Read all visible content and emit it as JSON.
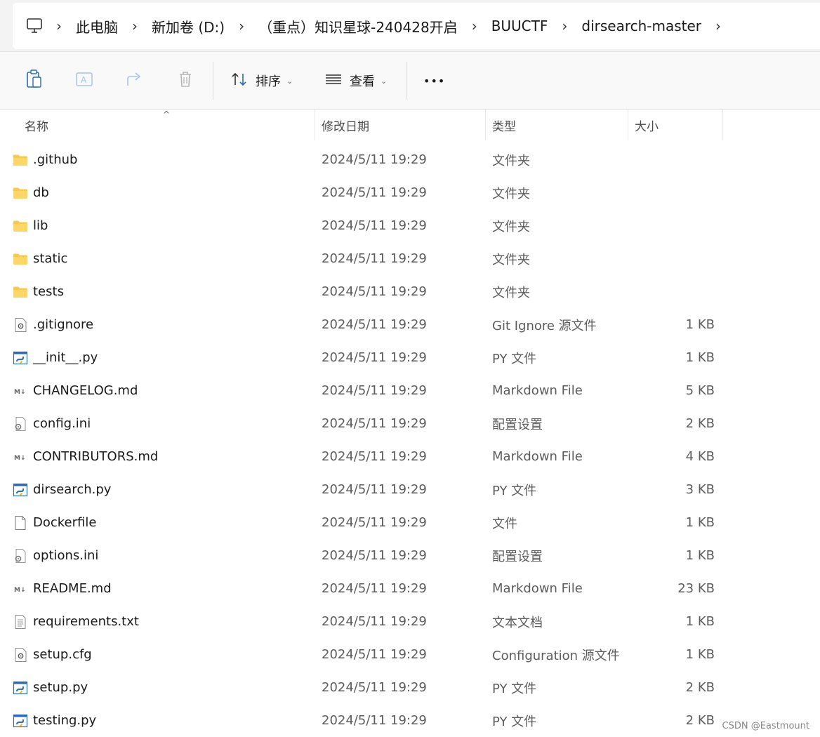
{
  "address": {
    "icon": "computer-icon",
    "crumbs": [
      "此电脑",
      "新加卷 (D:)",
      "（重点）知识星球-240428开启",
      "BUUCTF",
      "dirsearch-master"
    ],
    "separator": "›"
  },
  "toolbar": {
    "sort_label": "排序",
    "view_label": "查看",
    "more_label": "•••"
  },
  "columns": {
    "name": "名称",
    "date": "修改日期",
    "type": "类型",
    "size": "大小"
  },
  "files": [
    {
      "name": ".github",
      "date": "2024/5/11 19:29",
      "type": "文件夹",
      "size": "",
      "icon": "folder"
    },
    {
      "name": "db",
      "date": "2024/5/11 19:29",
      "type": "文件夹",
      "size": "",
      "icon": "folder"
    },
    {
      "name": "lib",
      "date": "2024/5/11 19:29",
      "type": "文件夹",
      "size": "",
      "icon": "folder"
    },
    {
      "name": "static",
      "date": "2024/5/11 19:29",
      "type": "文件夹",
      "size": "",
      "icon": "folder"
    },
    {
      "name": "tests",
      "date": "2024/5/11 19:29",
      "type": "文件夹",
      "size": "",
      "icon": "folder"
    },
    {
      "name": ".gitignore",
      "date": "2024/5/11 19:29",
      "type": "Git Ignore 源文件",
      "size": "1 KB",
      "icon": "gear"
    },
    {
      "name": "__init__.py",
      "date": "2024/5/11 19:29",
      "type": "PY 文件",
      "size": "1 KB",
      "icon": "python"
    },
    {
      "name": "CHANGELOG.md",
      "date": "2024/5/11 19:29",
      "type": "Markdown File",
      "size": "5 KB",
      "icon": "markdown"
    },
    {
      "name": "config.ini",
      "date": "2024/5/11 19:29",
      "type": "配置设置",
      "size": "2 KB",
      "icon": "ini"
    },
    {
      "name": "CONTRIBUTORS.md",
      "date": "2024/5/11 19:29",
      "type": "Markdown File",
      "size": "4 KB",
      "icon": "markdown"
    },
    {
      "name": "dirsearch.py",
      "date": "2024/5/11 19:29",
      "type": "PY 文件",
      "size": "3 KB",
      "icon": "python"
    },
    {
      "name": "Dockerfile",
      "date": "2024/5/11 19:29",
      "type": "文件",
      "size": "1 KB",
      "icon": "blank"
    },
    {
      "name": "options.ini",
      "date": "2024/5/11 19:29",
      "type": "配置设置",
      "size": "1 KB",
      "icon": "ini"
    },
    {
      "name": "README.md",
      "date": "2024/5/11 19:29",
      "type": "Markdown File",
      "size": "23 KB",
      "icon": "markdown"
    },
    {
      "name": "requirements.txt",
      "date": "2024/5/11 19:29",
      "type": "文本文档",
      "size": "1 KB",
      "icon": "text"
    },
    {
      "name": "setup.cfg",
      "date": "2024/5/11 19:29",
      "type": "Configuration 源文件",
      "size": "1 KB",
      "icon": "gear"
    },
    {
      "name": "setup.py",
      "date": "2024/5/11 19:29",
      "type": "PY 文件",
      "size": "2 KB",
      "icon": "python"
    },
    {
      "name": "testing.py",
      "date": "2024/5/11 19:29",
      "type": "PY 文件",
      "size": "2 KB",
      "icon": "python"
    }
  ],
  "watermark": "CSDN @Eastmount"
}
